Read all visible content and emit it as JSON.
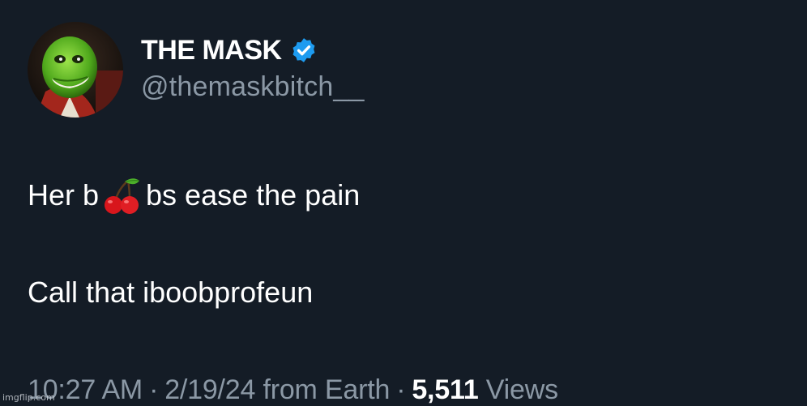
{
  "author": {
    "display_name": "THE MASK",
    "handle": "@themaskbitch__",
    "verified": true,
    "verified_color": "#1d9bf0",
    "avatar_icon": "green-mask-face-avatar"
  },
  "tweet": {
    "line1_before": "Her b",
    "line1_emoji": "cherries-icon",
    "line1_after": "bs ease the pain",
    "line2": "Call that iboobprofeun"
  },
  "meta": {
    "time": "10:27 AM",
    "separator": "·",
    "date": "2/19/24",
    "source": "from Earth",
    "views_count": "5,511",
    "views_label": "Views"
  },
  "watermark": "imgflip.com",
  "colors": {
    "background": "#141c26",
    "text_primary": "#ffffff",
    "text_secondary": "#8b98a5"
  }
}
